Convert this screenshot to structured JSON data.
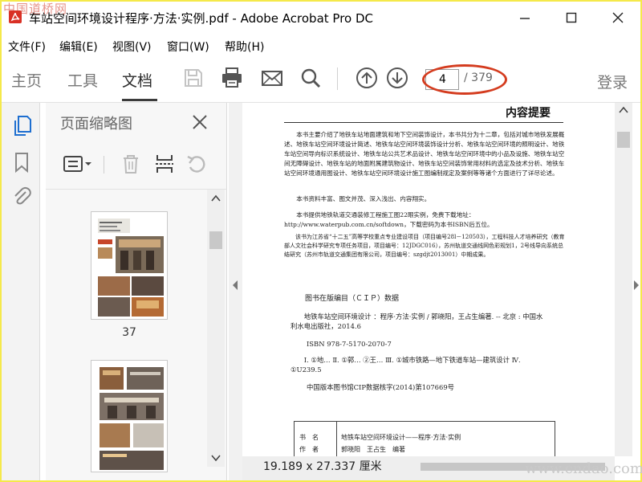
{
  "window": {
    "title": "车站空间环境设计程序·方法·实例.pdf - Adobe Acrobat Pro DC"
  },
  "menu": [
    "文件(F)",
    "编辑(E)",
    "视图(V)",
    "窗口(W)",
    "帮助(H)"
  ],
  "toolbar": {
    "tabs": [
      "主页",
      "工具",
      "文档"
    ],
    "active_tab": "文档",
    "page_current": "4",
    "page_total": "/ 379",
    "login": "登录"
  },
  "thumbnails": {
    "title": "页面缩略图",
    "pages": [
      {
        "label": "37"
      },
      {
        "label": ""
      }
    ]
  },
  "document": {
    "heading": "内容提要",
    "paragraphs": [
      "本书主要介绍了地铁车站地面建筑和地下空间装饰设计，本书共分为十二章，包括对城市地铁发展概述、地铁车站空间环境设计简述、地铁车站空间环境装饰设计分析、地铁车站空间环境的照明设计、地铁车站空间导向标识系统设计、地铁车站公共艺术品设计、地铁车站空间环境中的小品及设施、地铁车站空间无障碍设计、地铁车站的地面附属建筑物设计、地铁车站空间装饰常用材料的选定及技术分析、地铁车站空间环境通用图设计、地铁车站空间环境设计施工图编制规定及案例等等诸个方面进行了详尽论述。",
      "本书资料丰富、图文并茂、深入浅出、内容翔实。",
      "本书提供地铁轨道交通装修工程施工图22眼实例，免费下载地址：http://www.waterpub.com.cn/softdown，下载密码为本书ISBN后五位。",
      "该书为江苏省“十二五”高等学校重点专业建设项目（项目编号28l－120503），工程科技人才培养研究（教育部人文社会科学研究专项任务项目，项目编号：12JDGC016），苏州轨道交通线网色彩规划1，2号线导向系统总结研究（苏州市轨道交通集团有限公司，项目编号：szgdjt2013001）中期成果。"
    ],
    "cip_title": "图书在版编目（ＣＩＰ）数据",
    "cip_lines": [
      "地铁车站空间环境设计 ：程序·方法·实例 / 郭晓阳，王占生编著. -- 北京 : 中国水利水电出版社，2014.6",
      "ISBN 978-7-5170-2070-7",
      "Ⅰ. ①地… Ⅱ. ①郭… ②王… Ⅲ. ①城市铁路—地下铁道车站—建筑设计 Ⅳ. ①U239.5",
      "中国版本图书馆CIP数据核字(2014)第107669号"
    ],
    "table": {
      "row1_label": "书　名",
      "row1_value": "地铁车站空间环境设计——程序·方法·实例",
      "row2_label": "作　者",
      "row2_value": "郭晓阳　王占生　编著"
    }
  },
  "status": {
    "dimensions": "19.189 x 27.337 厘米"
  },
  "watermarks": {
    "top_left": "中国道桥网",
    "bottom_right": "www.cndao.com"
  },
  "colors": {
    "frame": "#f5e94a",
    "accent_blue": "#1e6fd0",
    "highlight_oval": "#d43c1f"
  }
}
